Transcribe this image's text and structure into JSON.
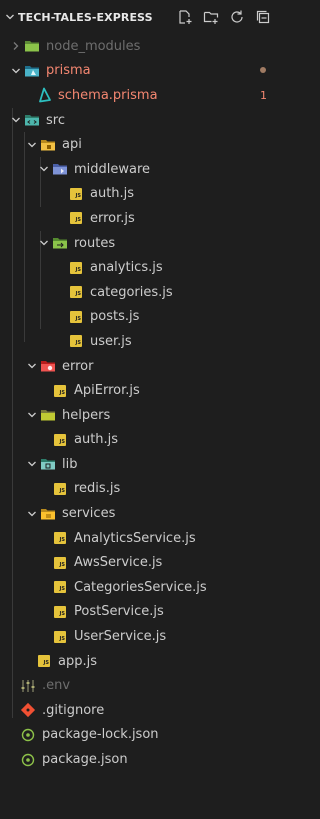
{
  "explorer": {
    "title": "TECH-TALES-EXPRESS",
    "actions": [
      "new-file-icon",
      "new-folder-icon",
      "refresh-icon",
      "collapse-all-icon"
    ]
  },
  "tree": {
    "node_modules": "node_modules",
    "prisma": "prisma",
    "schema": "schema.prisma",
    "schema_badge": "1",
    "src": "src",
    "api": "api",
    "middleware": "middleware",
    "auth_mw": "auth.js",
    "error_mw": "error.js",
    "routes": "routes",
    "analytics": "analytics.js",
    "categories": "categories.js",
    "posts": "posts.js",
    "user": "user.js",
    "error_folder": "error",
    "apierror": "ApiError.js",
    "helpers": "helpers",
    "auth_helper": "auth.js",
    "lib": "lib",
    "redis": "redis.js",
    "services": "services",
    "analytics_service": "AnalyticsService.js",
    "aws_service": "AwsService.js",
    "categories_service": "CategoriesService.js",
    "post_service": "PostService.js",
    "user_service": "UserService.js",
    "app": "app.js",
    "env": ".env",
    "gitignore": ".gitignore",
    "package_lock": "package-lock.json",
    "package": "package.json"
  },
  "colors": {
    "background": "#1e1e1e",
    "text": "#cccccc",
    "dim_text": "#6e6e6e",
    "error_text": "#f48771",
    "js_icon": "#e5c33b",
    "prisma_icon": "#2dbfbf",
    "json_icon": "#8dc149",
    "git_icon": "#f05033"
  }
}
